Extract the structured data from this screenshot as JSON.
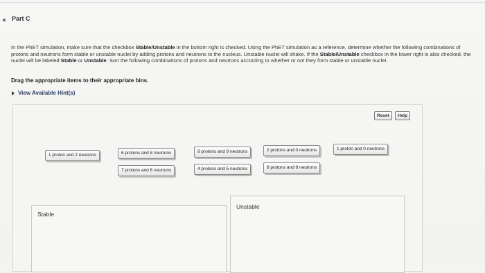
{
  "part": {
    "title": "Part C"
  },
  "instructions": {
    "segments": [
      {
        "text": "In the PhET simulation, make sure that the checkbox ",
        "bold": false
      },
      {
        "text": "Stable/Unstable",
        "bold": true
      },
      {
        "text": " in the bottom right is checked. Using the PhET simulation as a reference, determine whether the following combinations of protons and neutrons form stable or unstable nuclei by adding protons and neutrons to the nucleus. Unstable nuclei will shake. If the ",
        "bold": false
      },
      {
        "text": "Stable/Unstable",
        "bold": true
      },
      {
        "text": " checkbox in the lower right is also checked, the nuclei will be labeled ",
        "bold": false
      },
      {
        "text": "Stable",
        "bold": true
      },
      {
        "text": " or ",
        "bold": false
      },
      {
        "text": "Unstable",
        "bold": true
      },
      {
        "text": ". Sort the following combinations of protons and neutrons according to whether or not they form stable or unstable nuclei.",
        "bold": false
      }
    ],
    "drag_prompt": "Drag the appropriate items to their appropriate bins."
  },
  "hints": {
    "label": "View Available Hint(s)"
  },
  "toolbar": {
    "reset_label": "Reset",
    "help_label": "Help"
  },
  "items": [
    "1 proton and 2 neutrons",
    "6 protons and 8 neutrons",
    "9 protons and 9 neutrons",
    "2 protons and 0 neutrons",
    "1 proton and 0 neutrons",
    "7 protons and 6 neutrons",
    "4 protons and 5 neutrons",
    "8 protons and 8 neutrons"
  ],
  "bins": {
    "stable_label": "Stable",
    "unstable_label": "Unstable"
  }
}
